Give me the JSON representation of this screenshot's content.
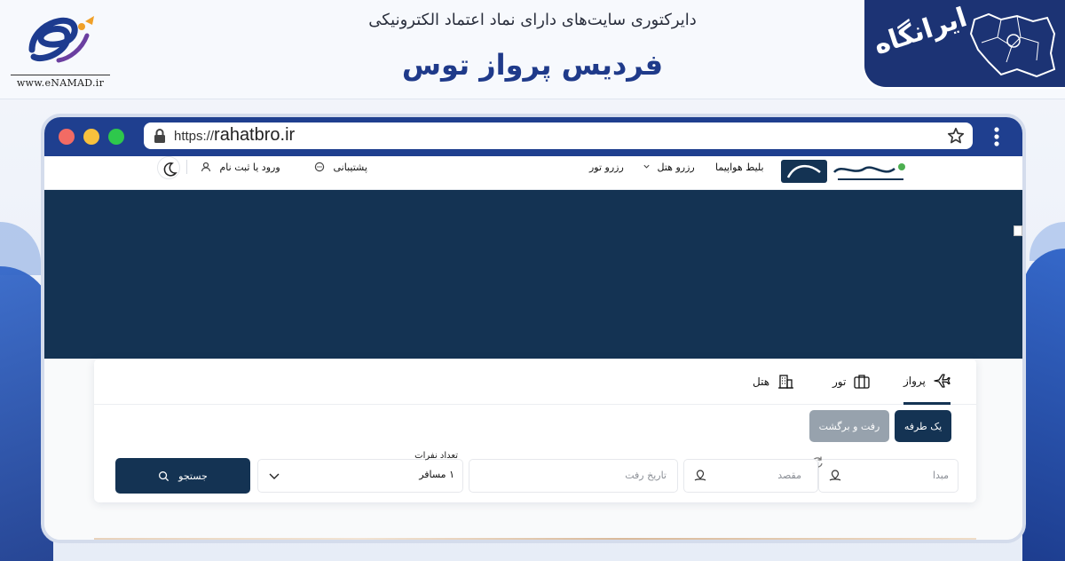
{
  "directory": {
    "subtitle": "دایرکتوری سایت‌های دارای نماد اعتماد الکترونیکی",
    "title": "فردیس پرواز توس",
    "enamad_url": "www.eNAMAD.ir",
    "irangah_logo_text": "ایرانگاه"
  },
  "browser": {
    "url_protocol": "https://",
    "url_domain": "rahatbro.ir"
  },
  "site": {
    "nav": {
      "login": "ورود یا ثبت نام",
      "support": "پشتیبانی",
      "tour": "رزرو تور",
      "hotel": "رزرو هتل",
      "flight": "بلیط هواپیما"
    },
    "tabs": [
      {
        "label": "پرواز",
        "icon": "airplane-icon",
        "active": true
      },
      {
        "label": "تور",
        "icon": "suitcase-icon",
        "active": false
      },
      {
        "label": "هتل",
        "icon": "building-icon",
        "active": false
      }
    ],
    "trip_type": {
      "one_way": "یک طرفه",
      "round_trip": "رفت و برگشت"
    },
    "fields": {
      "origin_placeholder": "مبدا",
      "destination_placeholder": "مقصد",
      "date_placeholder": "تاریخ رفت",
      "passengers_label": "تعداد نفرات",
      "passengers_value": "۱ مسافر"
    },
    "search_label": "جستجو"
  },
  "colors": {
    "brand_navy": "#143353",
    "browser_bar": "#1f3f8f",
    "directory_title": "#1f3a8a"
  }
}
